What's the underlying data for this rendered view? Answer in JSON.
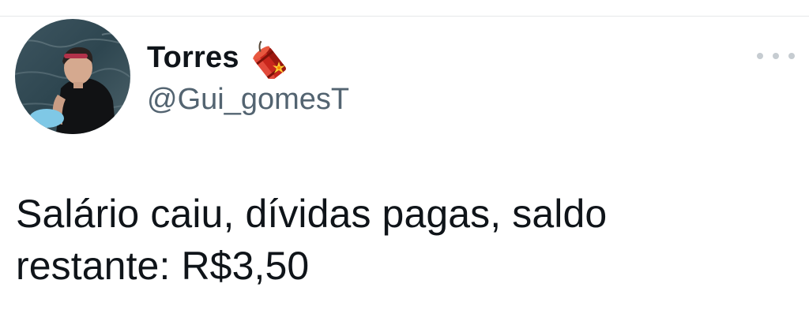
{
  "tweet": {
    "author": {
      "display_name": "Torres",
      "handle": "@Gui_gomesT",
      "name_badge": "firecracker-icon",
      "avatar": "profile-photo"
    },
    "more_options_icon": "more-horizontal-icon",
    "text_line1": "Salário caiu, dívidas pagas, saldo",
    "text_line2": "restante: R$3,50"
  },
  "colors": {
    "text_primary": "#0f1419",
    "text_secondary": "#536471",
    "divider": "#e6e8ea",
    "more_dots": "#c6ccd1"
  }
}
